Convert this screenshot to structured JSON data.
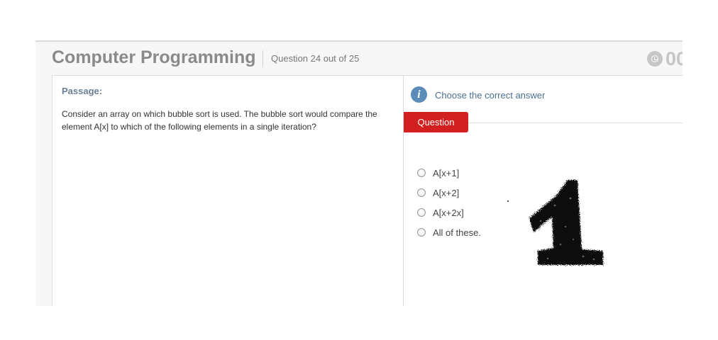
{
  "header": {
    "title": "Computer Programming",
    "question_count": "Question 24 out of 25",
    "timer_text": "00"
  },
  "passage": {
    "label": "Passage:",
    "text": "Consider an array on which bubble sort is used. The bubble sort would compare the element A[x] to which of the following elements in a single iteration?"
  },
  "question": {
    "info_icon_glyph": "i",
    "instruction": "Choose the correct answer",
    "tab_label": "Question",
    "options": [
      {
        "label": "A[x+1]",
        "selected": false
      },
      {
        "label": "A[x+2]",
        "selected": false
      },
      {
        "label": "A[x+2x]",
        "selected": false
      },
      {
        "label": "All of these.",
        "selected": false
      }
    ]
  },
  "overlay": {
    "handwritten_answer": "1"
  },
  "colors": {
    "tab_red": "#d21f1f",
    "info_blue": "#5b8db8",
    "title_gray": "#8a8a8a",
    "label_blue": "#6b7f95"
  }
}
